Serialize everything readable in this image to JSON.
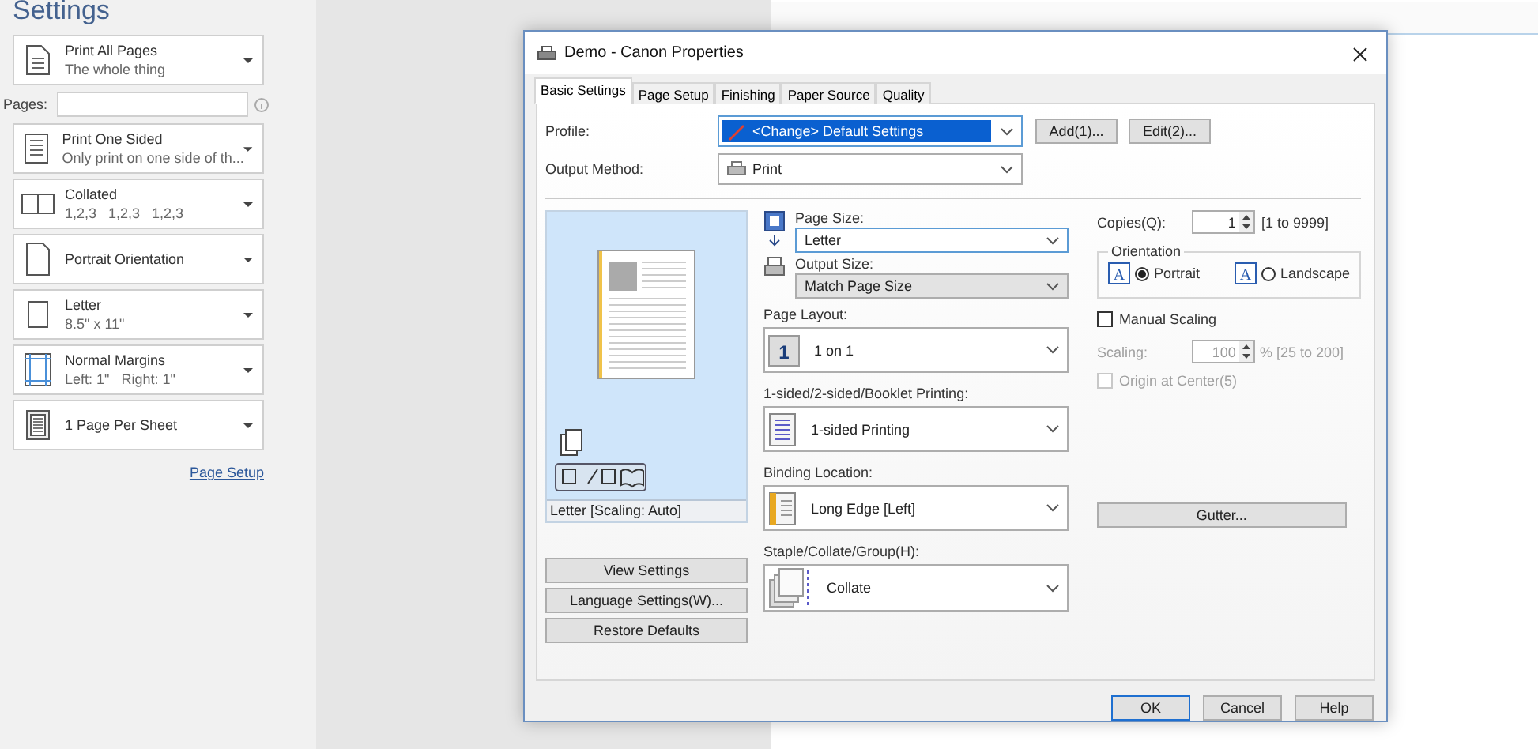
{
  "sidebar": {
    "title": "Settings",
    "items": [
      {
        "kind": "pages",
        "title": "Print All Pages",
        "subtitle": "The whole thing"
      },
      {
        "kind": "field",
        "label": "Pages:",
        "value": ""
      },
      {
        "kind": "sides",
        "title": "Print One Sided",
        "subtitle": "Only print on one side of th..."
      },
      {
        "kind": "collate",
        "title": "Collated",
        "subtitle": "1,2,3   1,2,3   1,2,3"
      },
      {
        "kind": "orientation",
        "title": "Portrait Orientation"
      },
      {
        "kind": "paper",
        "title": "Letter",
        "subtitle": "8.5\" x 11\""
      },
      {
        "kind": "margins",
        "title": "Normal Margins",
        "subtitle": "Left: 1\"   Right: 1\""
      },
      {
        "kind": "per-sheet",
        "title": "1 Page Per Sheet"
      }
    ],
    "link": "Page Setup"
  },
  "dialog": {
    "title": "Demo - Canon Properties",
    "tabs": [
      {
        "label": "Basic Settings",
        "selected": true
      },
      {
        "label": "Page Setup",
        "selected": false
      },
      {
        "label": "Finishing",
        "selected": false
      },
      {
        "label": "Paper Source",
        "selected": false
      },
      {
        "label": "Quality",
        "selected": false
      }
    ],
    "profile": {
      "label": "Profile:",
      "value": "<Change> Default Settings",
      "focused": true,
      "buttons": [
        "Add(1)...",
        "Edit(2)..."
      ]
    },
    "output_method": {
      "label": "Output Method:",
      "value": "Print"
    },
    "preview": {
      "caption": "Letter [Scaling: Auto]"
    },
    "left_buttons": [
      "View Settings",
      "Language Settings(W)...",
      "Restore Defaults"
    ],
    "page_size": {
      "label": "Page Size:",
      "value": "Letter",
      "focused": true
    },
    "output_size": {
      "label": "Output Size:",
      "value": "Match Page Size",
      "disabled": true
    },
    "selects": [
      {
        "kind": "layout",
        "label": "Page Layout:",
        "value": "1 on 1",
        "icon_text": "1"
      },
      {
        "kind": "sided",
        "label": "1-sided/2-sided/Booklet Printing:",
        "value": "1-sided Printing"
      },
      {
        "kind": "binding",
        "label": "Binding Location:",
        "value": "Long Edge [Left]"
      },
      {
        "kind": "staple",
        "label": "Staple/Collate/Group(H):",
        "value": "Collate"
      }
    ],
    "copies": {
      "label": "Copies(Q):",
      "value": "1",
      "range": "[1 to 9999]"
    },
    "orientation": {
      "label": "Orientation",
      "options": [
        {
          "label": "Portrait",
          "selected": true,
          "icon_text": "A"
        },
        {
          "label": "Landscape",
          "selected": false,
          "icon_text": "A"
        }
      ]
    },
    "manual_scaling": {
      "label": "Manual Scaling",
      "checked": false
    },
    "scaling": {
      "label": "Scaling:",
      "value": "100",
      "range": "% [25 to 200]",
      "disabled": true
    },
    "origin": {
      "label": "Origin at Center(5)",
      "checked": false,
      "disabled": true
    },
    "gutter": "Gutter...",
    "footer": [
      {
        "label": "OK",
        "default": true
      },
      {
        "label": "Cancel",
        "default": false
      },
      {
        "label": "Help",
        "default": false
      }
    ]
  }
}
